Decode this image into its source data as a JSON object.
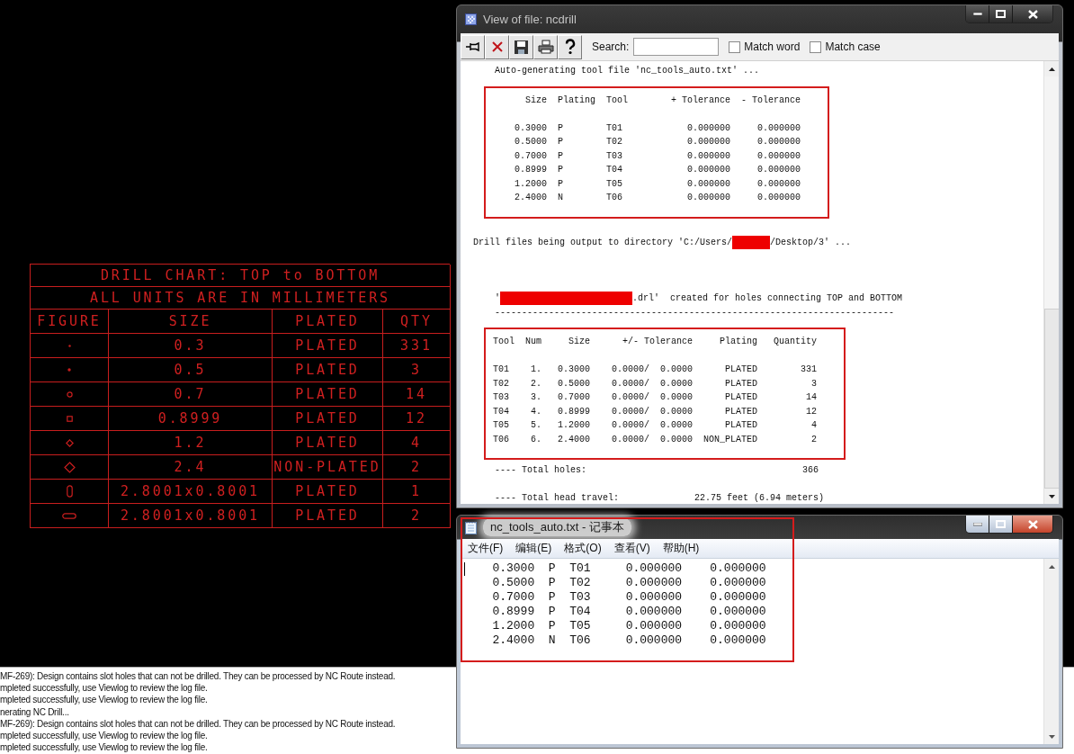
{
  "drill_chart": {
    "title": "DRILL CHART: TOP to BOTTOM",
    "subtitle": "ALL UNITS ARE IN MILLIMETERS",
    "columns": [
      "FIGURE",
      "SIZE",
      "PLATED",
      "QTY"
    ],
    "rows": [
      {
        "figure": {
          "kind": "tiny-dot"
        },
        "size": "0.3",
        "plated": "PLATED",
        "qty": "331"
      },
      {
        "figure": {
          "kind": "dot"
        },
        "size": "0.5",
        "plated": "PLATED",
        "qty": "3"
      },
      {
        "figure": {
          "kind": "small-circle"
        },
        "size": "0.7",
        "plated": "PLATED",
        "qty": "14"
      },
      {
        "figure": {
          "kind": "small-square"
        },
        "size": "0.8999",
        "plated": "PLATED",
        "qty": "12"
      },
      {
        "figure": {
          "kind": "small-diamond"
        },
        "size": "1.2",
        "plated": "PLATED",
        "qty": "4"
      },
      {
        "figure": {
          "kind": "large-diamond"
        },
        "size": "2.4",
        "plated": "NON-PLATED",
        "qty": "2"
      },
      {
        "figure": {
          "kind": "vertical-slot"
        },
        "size": "2.8001x0.8001",
        "plated": "PLATED",
        "qty": "1"
      },
      {
        "figure": {
          "kind": "horizontal-slot"
        },
        "size": "2.8001x0.8001",
        "plated": "PLATED",
        "qty": "2"
      }
    ]
  },
  "log": {
    "lines": [
      "MF-269): Design contains slot holes that can not be drilled. They can be processed by NC Route instead.",
      "mpleted successfully, use Viewlog to review the log file.",
      "mpleted successfully, use Viewlog to review the log file.",
      "nerating NC Drill...",
      "MF-269): Design contains slot holes that can not be drilled. They can be processed by NC Route instead.",
      "mpleted successfully, use Viewlog to review the log file.",
      "mpleted successfully, use Viewlog to review the log file."
    ]
  },
  "viewer": {
    "title": "View of file: ncdrill",
    "tools": [
      {
        "kind": "pin"
      },
      {
        "kind": "close"
      },
      {
        "kind": "save"
      },
      {
        "kind": "print"
      },
      {
        "kind": "help"
      }
    ],
    "search_label": "Search:",
    "checkboxes": [
      {
        "label": "Match word",
        "checked": false
      },
      {
        "label": "Match case",
        "checked": false
      }
    ],
    "blocks": [
      {
        "highlighted": false,
        "lines": [
          {
            "kind": "text",
            "text": "    Auto-generating tool file 'nc_tools_auto.txt' ..."
          }
        ]
      },
      {
        "highlighted": true,
        "lines": [
          {
            "kind": "text",
            "text": "      Size  Plating  Tool        + Tolerance  - Tolerance"
          },
          {
            "kind": "blank"
          },
          {
            "kind": "text",
            "text": "    0.3000  P        T01            0.000000     0.000000"
          },
          {
            "kind": "text",
            "text": "    0.5000  P        T02            0.000000     0.000000"
          },
          {
            "kind": "text",
            "text": "    0.7000  P        T03            0.000000     0.000000"
          },
          {
            "kind": "text",
            "text": "    0.8999  P        T04            0.000000     0.000000"
          },
          {
            "kind": "text",
            "text": "    1.2000  P        T05            0.000000     0.000000"
          },
          {
            "kind": "text",
            "text": "    2.4000  N        T06            0.000000     0.000000"
          }
        ]
      },
      {
        "highlighted": false,
        "lines": [
          {
            "kind": "blank"
          },
          {
            "kind": "mixed",
            "segments": [
              {
                "kind": "text",
                "text": "Drill files being output to directory 'C:/Users/"
              },
              {
                "kind": "redacted-short"
              },
              {
                "kind": "text",
                "text": "/Desktop/3' ..."
              }
            ]
          },
          {
            "kind": "blank"
          },
          {
            "kind": "blank"
          },
          {
            "kind": "blank"
          },
          {
            "kind": "mixed",
            "segments": [
              {
                "kind": "text",
                "text": "    '"
              },
              {
                "kind": "redacted-long"
              },
              {
                "kind": "text",
                "text": ".drl'  created for holes connecting TOP and BOTTOM"
              }
            ]
          },
          {
            "kind": "text",
            "text": "    --------------------------------------------------------------------------"
          }
        ]
      },
      {
        "highlighted": true,
        "lines": [
          {
            "kind": "text",
            "text": "Tool  Num     Size      +/- Tolerance     Plating   Quantity"
          },
          {
            "kind": "blank"
          },
          {
            "kind": "text",
            "text": "T01    1.   0.3000    0.0000/  0.0000      PLATED        331"
          },
          {
            "kind": "text",
            "text": "T02    2.   0.5000    0.0000/  0.0000      PLATED          3"
          },
          {
            "kind": "text",
            "text": "T03    3.   0.7000    0.0000/  0.0000      PLATED         14"
          },
          {
            "kind": "text",
            "text": "T04    4.   0.8999    0.0000/  0.0000      PLATED         12"
          },
          {
            "kind": "text",
            "text": "T05    5.   1.2000    0.0000/  0.0000      PLATED          4"
          },
          {
            "kind": "text",
            "text": "T06    6.   2.4000    0.0000/  0.0000  NON_PLATED          2"
          }
        ]
      },
      {
        "highlighted": false,
        "lines": [
          {
            "kind": "text",
            "text": "    ---- Total holes:                                        366"
          },
          {
            "kind": "blank"
          },
          {
            "kind": "text",
            "text": "    ---- Total head travel:              22.75 feet (6.94 meters)"
          }
        ]
      }
    ]
  },
  "notepad": {
    "title": "nc_tools_auto.txt - 记事本",
    "highlighted": true,
    "menu": [
      "文件(F)",
      "编辑(E)",
      "格式(O)",
      "查看(V)",
      "帮助(H)"
    ],
    "lines": [
      "   0.3000  P  T01     0.000000    0.000000",
      "   0.5000  P  T02     0.000000    0.000000",
      "   0.7000  P  T03     0.000000    0.000000",
      "   0.8999  P  T04     0.000000    0.000000",
      "   1.2000  P  T05     0.000000    0.000000",
      "   2.4000  N  T06     0.000000    0.000000"
    ]
  }
}
